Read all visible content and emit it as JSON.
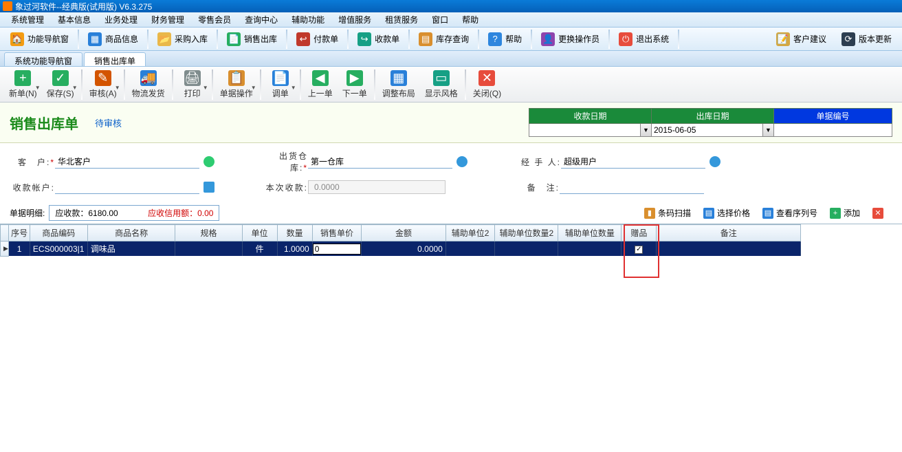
{
  "title": "象过河软件--经典版(试用版)  V6.3.275",
  "menu": [
    "系统管理",
    "基本信息",
    "业务处理",
    "财务管理",
    "零售会员",
    "查询中心",
    "辅助功能",
    "增值服务",
    "租赁服务",
    "窗口",
    "帮助"
  ],
  "toolbar": [
    {
      "label": "功能导航窗",
      "icon": "🏠",
      "bg": "#f39c12"
    },
    {
      "label": "商品信息",
      "icon": "▦",
      "bg": "#2980d9"
    },
    {
      "label": "采购入库",
      "icon": "📂",
      "bg": "#e9b84a"
    },
    {
      "label": "销售出库",
      "icon": "📄",
      "bg": "#27ae60"
    },
    {
      "label": "付款单",
      "icon": "↩",
      "bg": "#c0392b"
    },
    {
      "label": "收款单",
      "icon": "↪",
      "bg": "#16a085"
    },
    {
      "label": "库存查询",
      "icon": "▤",
      "bg": "#d98f2e"
    },
    {
      "label": "帮助",
      "icon": "?",
      "bg": "#2e86de"
    },
    {
      "label": "更换操作员",
      "icon": "👤",
      "bg": "#8e44ad"
    },
    {
      "label": "退出系统",
      "icon": "⏻",
      "bg": "#e74c3c"
    },
    {
      "label": "客户建议",
      "icon": "📝",
      "bg": "#d4a843"
    },
    {
      "label": "版本更新",
      "icon": "⟳",
      "bg": "#2c3e50"
    }
  ],
  "tabs": [
    {
      "label": "系统功能导航窗",
      "active": false
    },
    {
      "label": "销售出库单",
      "active": true
    }
  ],
  "doc_toolbar": [
    {
      "label": "新单(N)",
      "icon": "+",
      "bg": "#27ae60",
      "arrow": true
    },
    {
      "label": "保存(S)",
      "icon": "✓",
      "bg": "#27ae60",
      "arrow": true
    },
    {
      "label": "审核(A)",
      "icon": "✎",
      "bg": "#d35400",
      "arrow": true,
      "sep_before": true
    },
    {
      "label": "物流发货",
      "icon": "🚚",
      "bg": "#2980d9",
      "sep_before": true
    },
    {
      "label": "打印",
      "icon": "🖨",
      "bg": "#7f8c8d",
      "arrow": true,
      "sep_before": true
    },
    {
      "label": "单据操作",
      "icon": "📋",
      "bg": "#d98f2e",
      "arrow": true,
      "sep_before": true
    },
    {
      "label": "调单",
      "icon": "📄",
      "bg": "#2980d9",
      "arrow": true,
      "sep_before": true
    },
    {
      "label": "上一单",
      "icon": "◀",
      "bg": "#27ae60",
      "sep_before": true
    },
    {
      "label": "下一单",
      "icon": "▶",
      "bg": "#27ae60"
    },
    {
      "label": "调整布局",
      "icon": "▦",
      "bg": "#2980d9",
      "sep_before": true
    },
    {
      "label": "显示风格",
      "icon": "▭",
      "bg": "#16a085"
    },
    {
      "label": "关闭(Q)",
      "icon": "✕",
      "bg": "#e74c3c",
      "sep_before": true
    }
  ],
  "form": {
    "title": "销售出库单",
    "status": "待审核",
    "date_headers": [
      "收款日期",
      "出库日期",
      "单据编号"
    ],
    "out_date": "2015-06-05",
    "receipt_date": "",
    "bill_no": "",
    "customer_label": "客　户:",
    "customer": "华北客户",
    "warehouse_label": "出货仓库:",
    "warehouse": "第一仓库",
    "handler_label": "经 手 人:",
    "handler": "超级用户",
    "account_label": "收款帐户:",
    "account": "",
    "this_pay_label": "本次收款:",
    "this_pay": "0.0000",
    "remark_label": "备　注:",
    "remark": "",
    "detail_label": "单据明细:",
    "receivable": "应收款：6180.00",
    "credit": "应收信用额：0.00"
  },
  "actions": [
    {
      "label": "条码扫描",
      "icon": "▮",
      "bg": "#d98f2e"
    },
    {
      "label": "选择价格",
      "icon": "▤",
      "bg": "#2980d9"
    },
    {
      "label": "查看序列号",
      "icon": "▤",
      "bg": "#2980d9"
    },
    {
      "label": "添加",
      "icon": "+",
      "bg": "#27ae60"
    }
  ],
  "grid": {
    "columns": [
      "序号",
      "商品编码",
      "商品名称",
      "规格",
      "单位",
      "数量",
      "销售单价",
      "金额",
      "辅助单位2",
      "辅助单位数量2",
      "辅助单位数量",
      "赠品",
      "备注"
    ],
    "widths": [
      30,
      82,
      125,
      95,
      50,
      50,
      70,
      120,
      70,
      90,
      90,
      50,
      205
    ],
    "row": {
      "seq": "1",
      "code": "ECS000003|1",
      "name": "调味品",
      "spec": "",
      "unit": "件",
      "qty": "1.0000",
      "price": "0",
      "amount": "0.0000",
      "aux2": "",
      "aux2qty": "",
      "auxqty": "",
      "gift": true,
      "remark": ""
    }
  }
}
